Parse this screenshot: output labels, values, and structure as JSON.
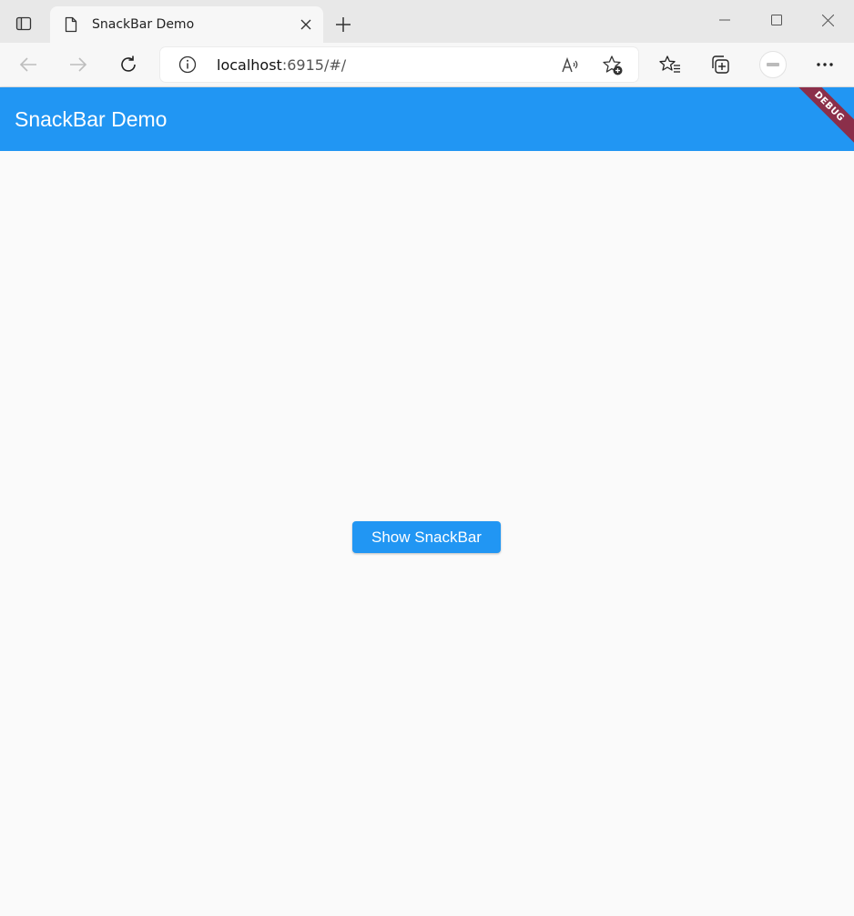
{
  "browser": {
    "tab": {
      "title": "SnackBar Demo",
      "icon": "page-icon"
    },
    "address": {
      "host": "localhost",
      "rest": ":6915/#/"
    }
  },
  "app": {
    "title": "SnackBar Demo",
    "debug_banner": "DEBUG",
    "button_label": "Show SnackBar",
    "colors": {
      "primary": "#2196f3",
      "background": "#fafafa",
      "debug_banner": "#8b2f4a"
    }
  }
}
